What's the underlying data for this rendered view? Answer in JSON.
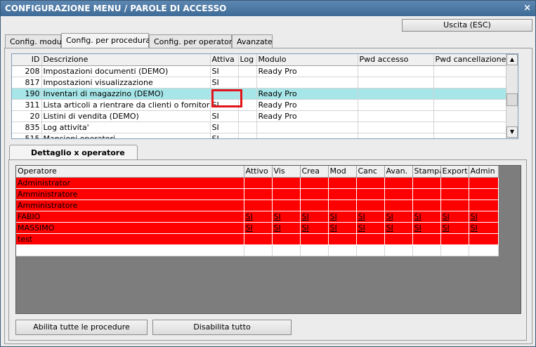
{
  "window": {
    "title": "CONFIGURAZIONE MENU / PAROLE DI ACCESSO",
    "close_label": "×"
  },
  "toolbar": {
    "exit_label": "Uscita (ESC)"
  },
  "tabs": [
    {
      "label": "Config. moduli"
    },
    {
      "label": "Config. per procedura"
    },
    {
      "label": "Config. per operatore"
    },
    {
      "label": "Avanzate"
    }
  ],
  "procedures": {
    "columns": [
      "ID",
      "Descrizione",
      "Attiva",
      "Log",
      "Modulo",
      "Pwd accesso",
      "Pwd cancellazione"
    ],
    "rows": [
      {
        "id": "208",
        "descr": "Impostazioni documenti (DEMO)",
        "attiva": "SI",
        "log": "",
        "modulo": "Ready Pro",
        "pwd_acc": "",
        "pwd_canc": ""
      },
      {
        "id": "817",
        "descr": "Impostazioni visualizzazione",
        "attiva": "SI",
        "log": "",
        "modulo": "",
        "pwd_acc": "",
        "pwd_canc": ""
      },
      {
        "id": "190",
        "descr": "Inventari di magazzino (DEMO)",
        "attiva": "",
        "log": "",
        "modulo": "Ready Pro",
        "pwd_acc": "",
        "pwd_canc": ""
      },
      {
        "id": "311",
        "descr": "Lista articoli a rientrare da clienti o fornitori (D...",
        "attiva": "SI",
        "log": "",
        "modulo": "Ready Pro",
        "pwd_acc": "",
        "pwd_canc": ""
      },
      {
        "id": "20",
        "descr": "Listini di vendita (DEMO)",
        "attiva": "SI",
        "log": "",
        "modulo": "Ready Pro",
        "pwd_acc": "",
        "pwd_canc": ""
      },
      {
        "id": "835",
        "descr": "Log attivita'",
        "attiva": "SI",
        "log": "",
        "modulo": "",
        "pwd_acc": "",
        "pwd_canc": ""
      },
      {
        "id": "515",
        "descr": "Mansioni operatori",
        "attiva": "SI",
        "log": "",
        "modulo": "",
        "pwd_acc": "",
        "pwd_canc": ""
      }
    ],
    "selected_row_index": 2
  },
  "detail_tab": {
    "label": "Dettaglio x operatore"
  },
  "operators": {
    "columns": [
      "Operatore",
      "Attivo",
      "Vis",
      "Crea",
      "Mod",
      "Canc",
      "Avan.",
      "Stampa",
      "Export",
      "Admin"
    ],
    "rows": [
      {
        "name": "Administrator",
        "vals": [
          "",
          "",
          "",
          "",
          "",
          "",
          "",
          "",
          ""
        ]
      },
      {
        "name": "Amministratore",
        "vals": [
          "",
          "",
          "",
          "",
          "",
          "",
          "",
          "",
          ""
        ]
      },
      {
        "name": "Amministratore",
        "vals": [
          "",
          "",
          "",
          "",
          "",
          "",
          "",
          "",
          ""
        ]
      },
      {
        "name": "FABIO",
        "vals": [
          "SI",
          "SI",
          "SI",
          "SI",
          "SI",
          "SI",
          "SI",
          "SI",
          "SI"
        ]
      },
      {
        "name": "MASSIMO",
        "vals": [
          "SI",
          "SI",
          "SI",
          "SI",
          "SI",
          "SI",
          "SI",
          "SI",
          "SI"
        ]
      },
      {
        "name": "test",
        "vals": [
          "",
          "",
          "",
          "",
          "",
          "",
          "",
          "",
          ""
        ]
      }
    ]
  },
  "buttons": {
    "enable_all": "Abilita tutte le procedure",
    "disable_all": "Disabilita tutto"
  },
  "colors": {
    "title_bar": "#3e6b97",
    "selected_row": "#a6e6e8",
    "operator_row": "#ff0000",
    "highlight_box": "#e0141a"
  }
}
